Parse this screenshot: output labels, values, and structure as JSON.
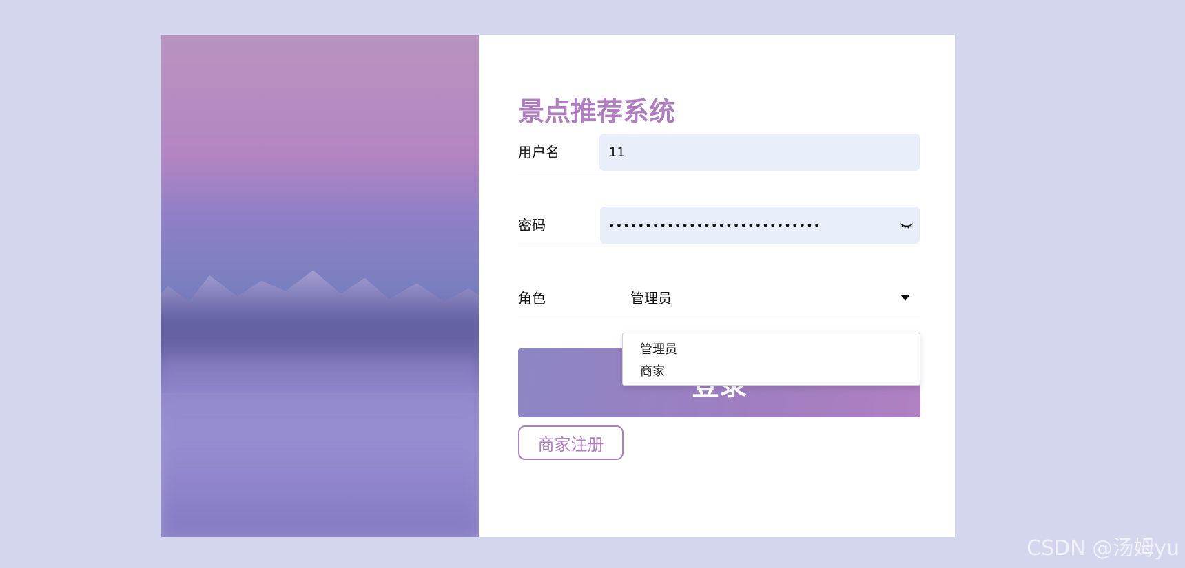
{
  "app": {
    "title": "景点推荐系统"
  },
  "form": {
    "username": {
      "label": "用户名",
      "value": "11"
    },
    "password": {
      "label": "密码",
      "value_masked": "•••••••••••••••••••••••••••••"
    },
    "role": {
      "label": "角色",
      "selected": "管理员",
      "options": [
        "管理员",
        "商家"
      ]
    },
    "buttons": {
      "login": "登录",
      "register": "商家注册"
    }
  },
  "watermark": "CSDN @汤姆yu",
  "colors": {
    "page_background": "#d4d6ee",
    "accent_purple": "#b07fc0",
    "input_background": "#e8effb",
    "login_gradient_start": "#8c86c5",
    "login_gradient_end": "#b080c2"
  }
}
